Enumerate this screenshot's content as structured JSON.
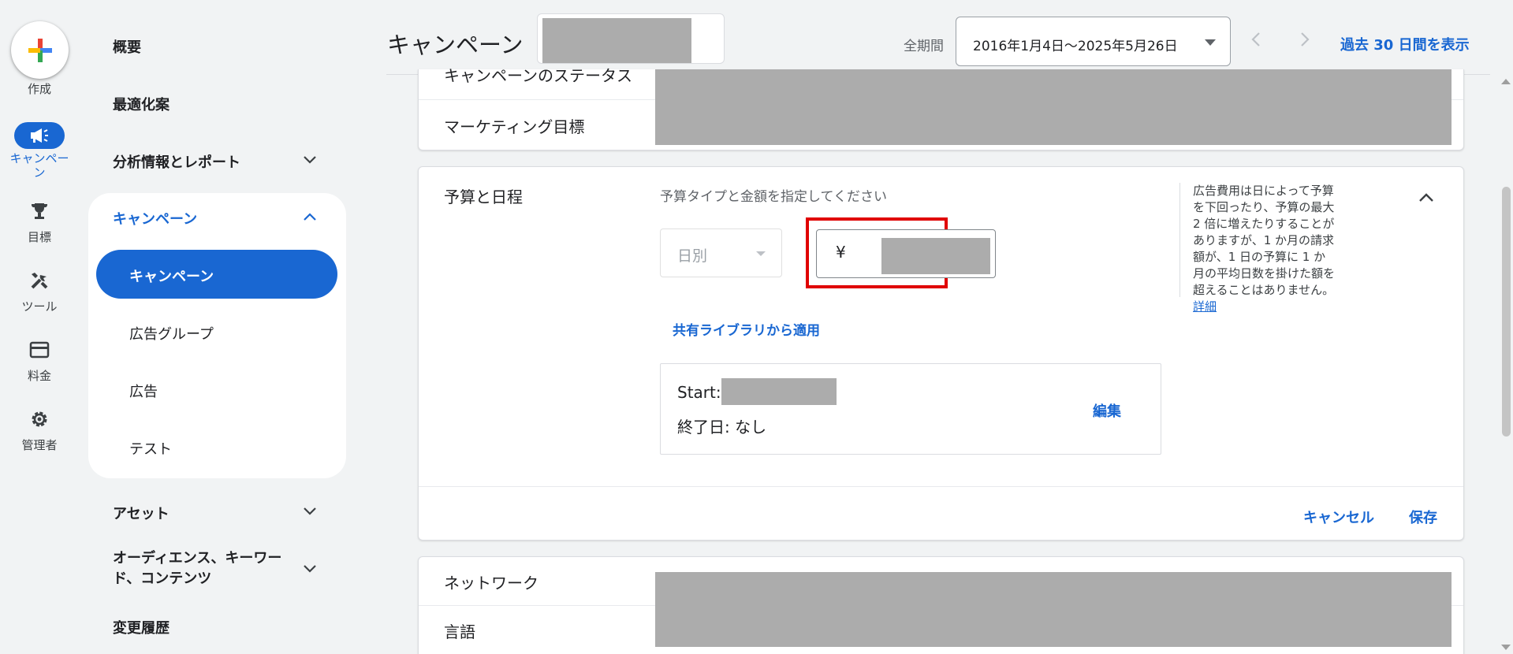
{
  "rail": {
    "create_label": "作成",
    "campaign_label": "キャンペーン",
    "goals_label": "目標",
    "tools_label": "ツール",
    "billing_label": "料金",
    "admin_label": "管理者"
  },
  "sidebar": {
    "overview": "概要",
    "recommendations": "最適化案",
    "insights": "分析情報とレポート",
    "campaigns_group": "キャンペーン",
    "sub": {
      "campaigns": "キャンペーン",
      "ad_groups": "広告グループ",
      "ads": "広告",
      "tests": "テスト"
    },
    "assets": "アセット",
    "audiences": "オーディエンス、キーワード、コンテンツ",
    "change_history": "変更履歴"
  },
  "header": {
    "title": "キャンペーン",
    "period_label": "全期間",
    "date_range": "2016年1月4日～2025年5月26日",
    "last_30_days": "過去 30 日間を表示"
  },
  "rows": {
    "campaign_status": "キャンペーンのステータス",
    "marketing_goal": "マーケティング目標",
    "network": "ネットワーク",
    "language": "言語"
  },
  "budget": {
    "section_title": "予算と日程",
    "hint": "予算タイプと金額を指定してください",
    "type_value": "日別",
    "currency_symbol": "¥",
    "shared_library_link": "共有ライブラリから適用",
    "start_label": "Start:",
    "end_label": "終了日: なし",
    "edit_label": "編集",
    "side_note": "広告費用は日によって予算を下回ったり、予算の最大 2 倍に増えたりすることがありますが、1 か月の請求額が、1 日の予算に 1 か月の平均日数を掛けた額を超えることはありません。",
    "details_link": "詳細",
    "cancel_label": "キャンセル",
    "save_label": "保存"
  },
  "colors": {
    "accent": "#1967d2",
    "highlight_border": "#e00000",
    "redaction": "#acacac"
  }
}
